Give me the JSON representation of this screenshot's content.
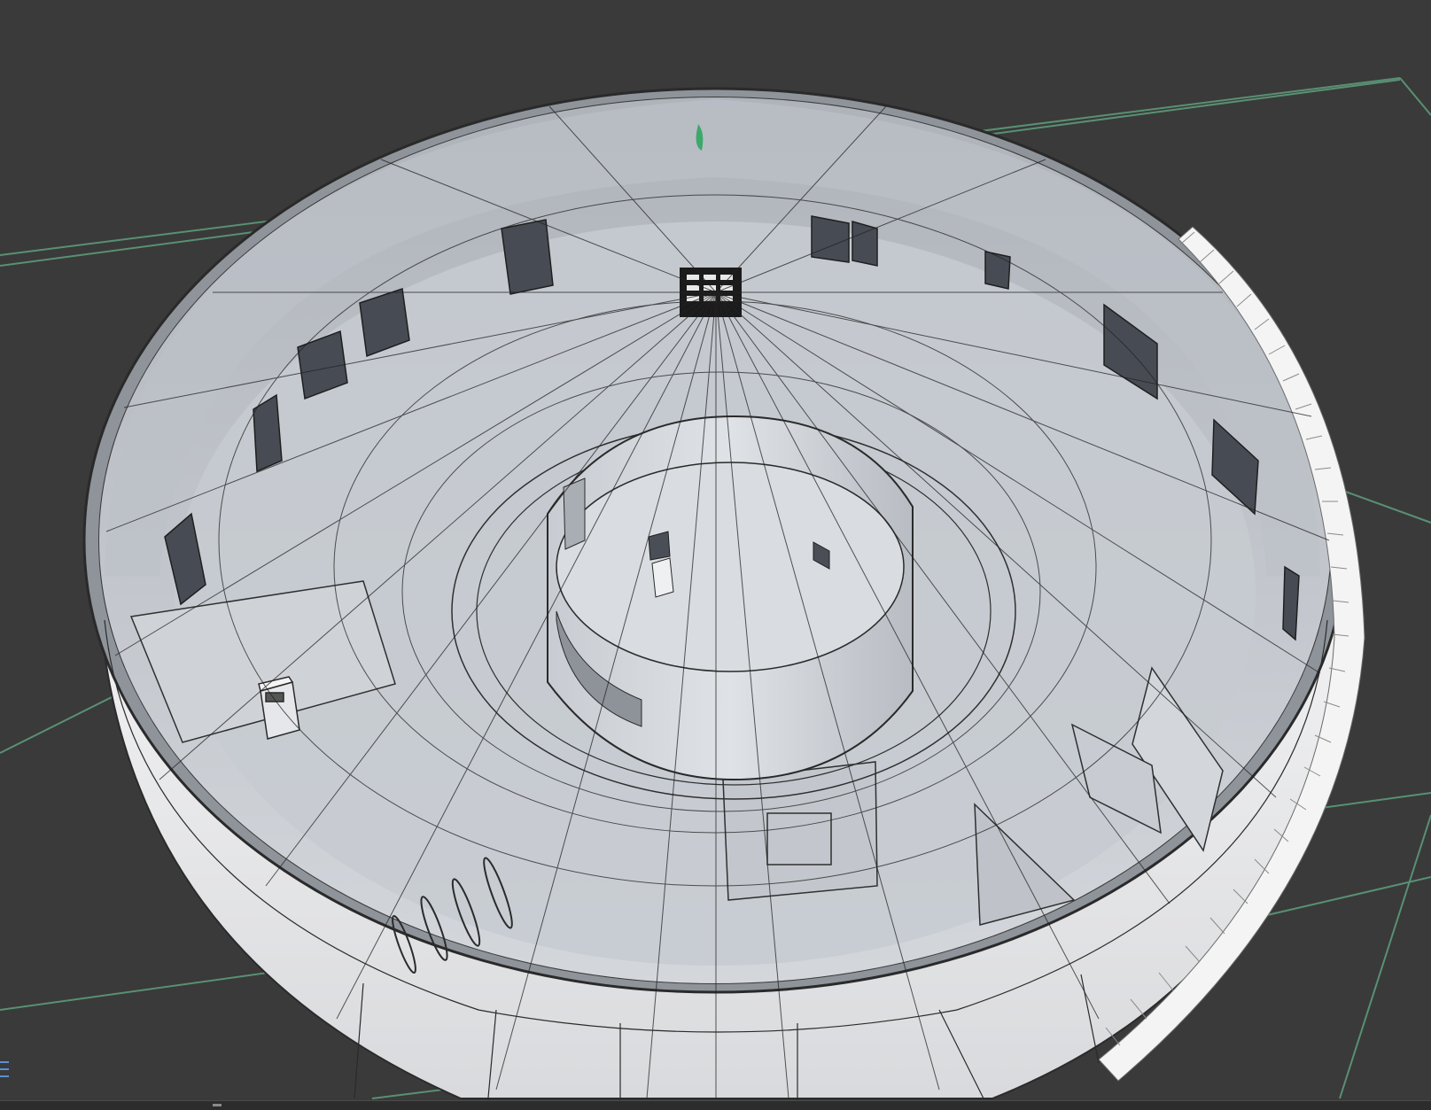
{
  "viewport": {
    "background_color": "#3a3a3a",
    "grid_line_color": "#5fa07e",
    "wireframe_color": "#222222"
  },
  "model": {
    "outer_wall_color": "#e8e8ea",
    "floor_color": "#c9ccd1",
    "inner_wall_color": "#bfc3c9",
    "panel_color": "#4a4f57",
    "stair_color": "#f0f0f0"
  },
  "gizmo": {
    "icon": "axis-gizmo-icon"
  }
}
